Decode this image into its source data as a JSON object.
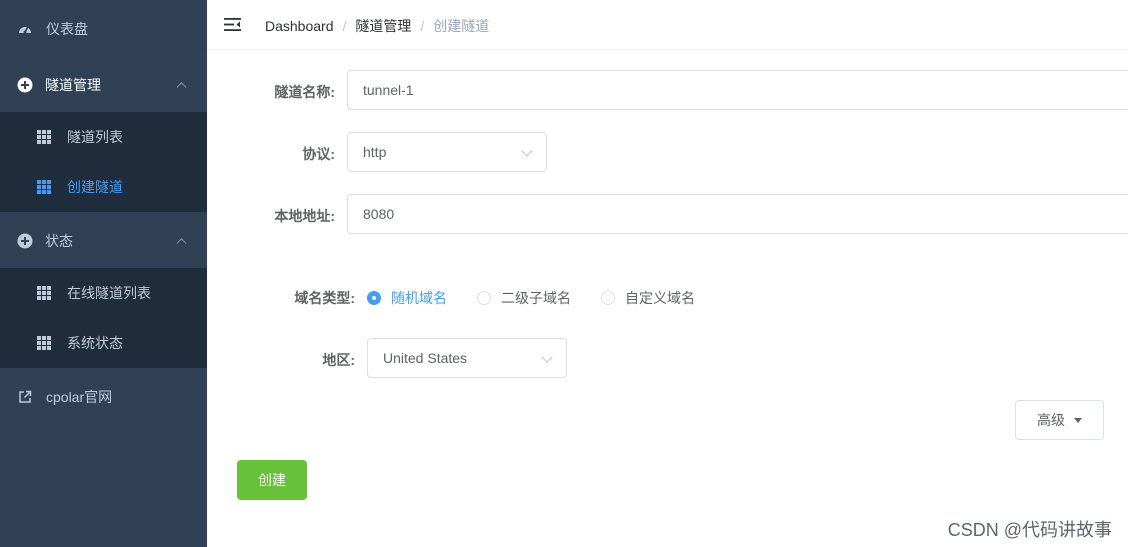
{
  "sidebar": {
    "dashboard_label": "仪表盘",
    "tunnel_mgmt": {
      "label": "隧道管理",
      "items": [
        {
          "label": "隧道列表"
        },
        {
          "label": "创建隧道"
        }
      ]
    },
    "status": {
      "label": "状态",
      "items": [
        {
          "label": "在线隧道列表"
        },
        {
          "label": "系统状态"
        }
      ]
    },
    "website_label": "cpolar官网"
  },
  "breadcrumb": [
    "Dashboard",
    "隧道管理",
    "创建隧道"
  ],
  "breadcrumb_sep": "/",
  "form": {
    "name_label": "隧道名称:",
    "name_value": "tunnel-1",
    "protocol_label": "协议:",
    "protocol_value": "http",
    "local_label": "本地地址:",
    "local_value": "8080",
    "domain_type_label": "域名类型:",
    "domain_options": [
      "随机域名",
      "二级子域名",
      "自定义域名"
    ],
    "domain_selected": "随机域名",
    "region_label": "地区:",
    "region_value": "United States",
    "advanced_label": "高级",
    "create_label": "创建"
  },
  "watermark": "CSDN @代码讲故事",
  "colors": {
    "sidebar_bg": "#304156",
    "submenu_bg": "#1f2d3d",
    "active": "#409eff",
    "create_btn": "#67c23a"
  }
}
